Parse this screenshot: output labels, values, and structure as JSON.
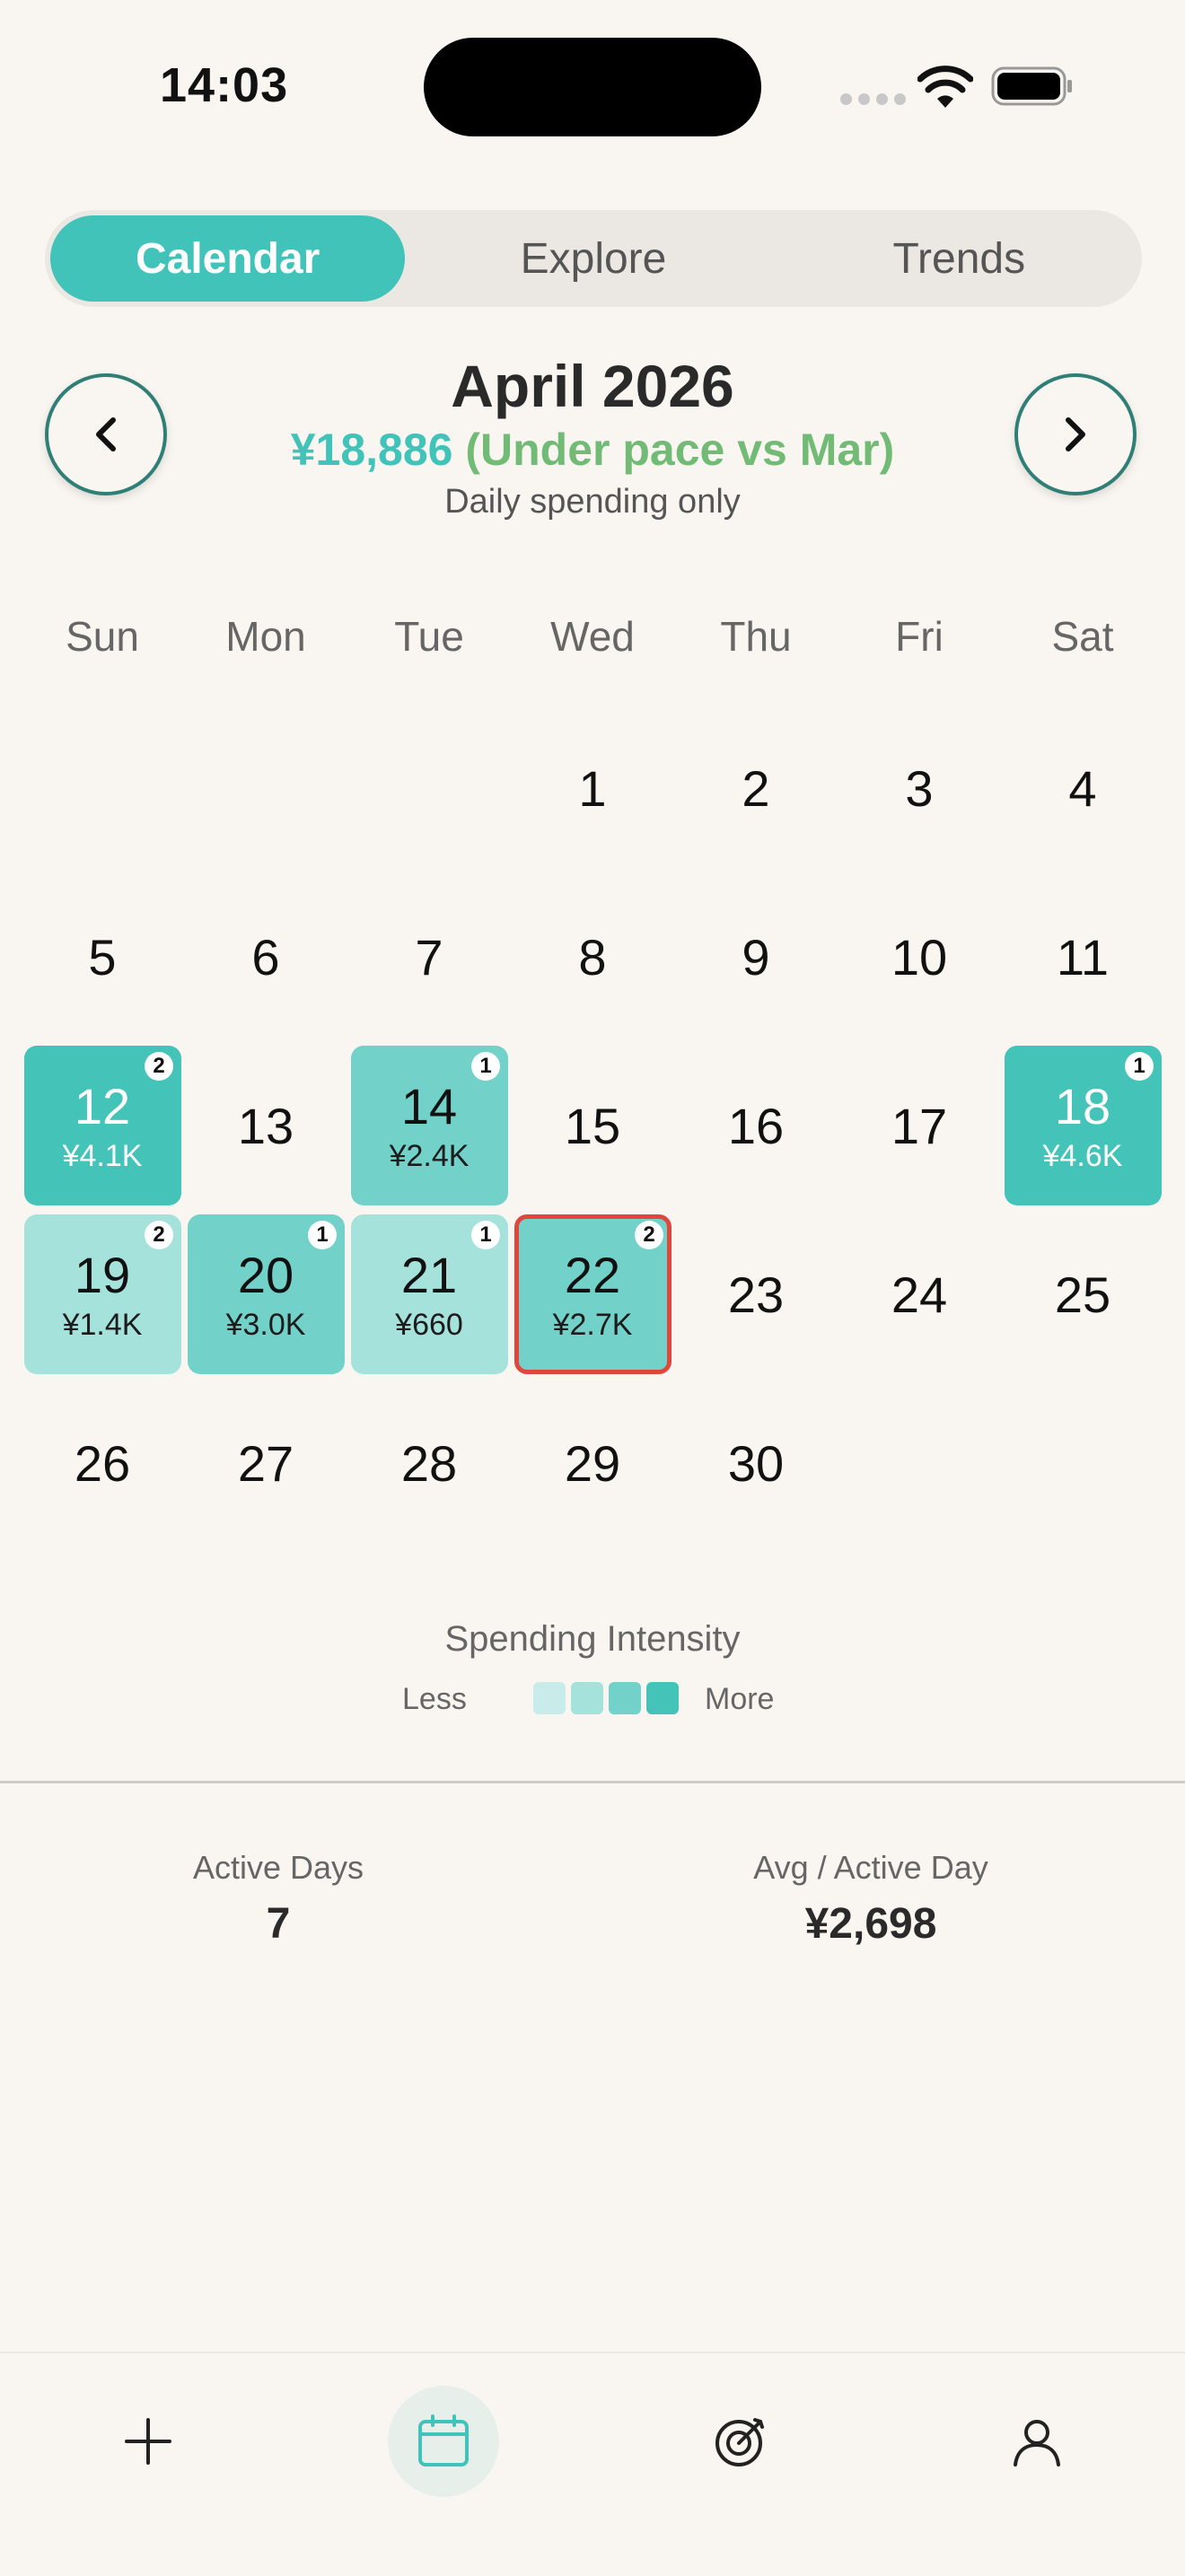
{
  "status_bar": {
    "time": "14:03"
  },
  "tabs": [
    {
      "label": "Calendar",
      "active": true
    },
    {
      "label": "Explore",
      "active": false
    },
    {
      "label": "Trends",
      "active": false
    }
  ],
  "header": {
    "prev_label": "‹",
    "next_label": "›",
    "title": "April 2026",
    "total": "¥18,886",
    "pace": "(Under pace vs Mar)",
    "subtitle": "Daily spending only"
  },
  "weekdays": [
    "Sun",
    "Mon",
    "Tue",
    "Wed",
    "Thu",
    "Fri",
    "Sat"
  ],
  "calendar": {
    "first_weekday_index": 3,
    "days": [
      {
        "day": "1"
      },
      {
        "day": "2"
      },
      {
        "day": "3"
      },
      {
        "day": "4"
      },
      {
        "day": "5"
      },
      {
        "day": "6"
      },
      {
        "day": "7"
      },
      {
        "day": "8"
      },
      {
        "day": "9"
      },
      {
        "day": "10"
      },
      {
        "day": "11"
      },
      {
        "day": "12",
        "amount": "¥4.1K",
        "count": "2",
        "level": 3
      },
      {
        "day": "13"
      },
      {
        "day": "14",
        "amount": "¥2.4K",
        "count": "1",
        "level": 2
      },
      {
        "day": "15"
      },
      {
        "day": "16"
      },
      {
        "day": "17"
      },
      {
        "day": "18",
        "amount": "¥4.6K",
        "count": "1",
        "level": 3
      },
      {
        "day": "19",
        "amount": "¥1.4K",
        "count": "2",
        "level": 1
      },
      {
        "day": "20",
        "amount": "¥3.0K",
        "count": "1",
        "level": 2
      },
      {
        "day": "21",
        "amount": "¥660",
        "count": "1",
        "level": 1
      },
      {
        "day": "22",
        "amount": "¥2.7K",
        "count": "2",
        "level": 2,
        "selected": true
      },
      {
        "day": "23"
      },
      {
        "day": "24"
      },
      {
        "day": "25"
      },
      {
        "day": "26"
      },
      {
        "day": "27"
      },
      {
        "day": "28"
      },
      {
        "day": "29"
      },
      {
        "day": "30"
      }
    ]
  },
  "legend": {
    "title": "Spending Intensity",
    "less": "Less",
    "more": "More",
    "colors": [
      "#c9ecea",
      "#a5e2dc",
      "#72d1c9",
      "#44c3b9"
    ]
  },
  "stats": {
    "active_days_label": "Active Days",
    "active_days_value": "7",
    "avg_label": "Avg / Active Day",
    "avg_value": "¥2,698"
  },
  "tabbar": {
    "items": [
      {
        "icon": "plus-icon",
        "active": false
      },
      {
        "icon": "calendar-icon",
        "active": true
      },
      {
        "icon": "target-icon",
        "active": false
      },
      {
        "icon": "profile-icon",
        "active": false
      }
    ]
  },
  "colors": {
    "accent": "#41c3b9",
    "pace_green": "#72bb76",
    "selected_border": "#e0473c",
    "background": "#f9f6f1"
  }
}
